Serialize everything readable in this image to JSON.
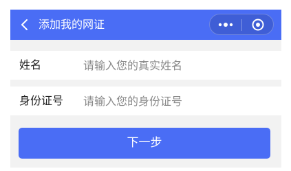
{
  "nav": {
    "title": "添加我的网证",
    "back_icon": "chevron-left-icon",
    "more_icon": "more-dots-icon",
    "close_icon": "target-circle-icon",
    "background": "#4a6df5"
  },
  "form": {
    "name": {
      "label": "姓名",
      "placeholder": "请输入您的真实姓名",
      "value": ""
    },
    "id_number": {
      "label": "身份证号",
      "placeholder": "请输入您的身份证号",
      "value": ""
    }
  },
  "actions": {
    "next_label": "下一步",
    "accent": "#4a6df5"
  }
}
